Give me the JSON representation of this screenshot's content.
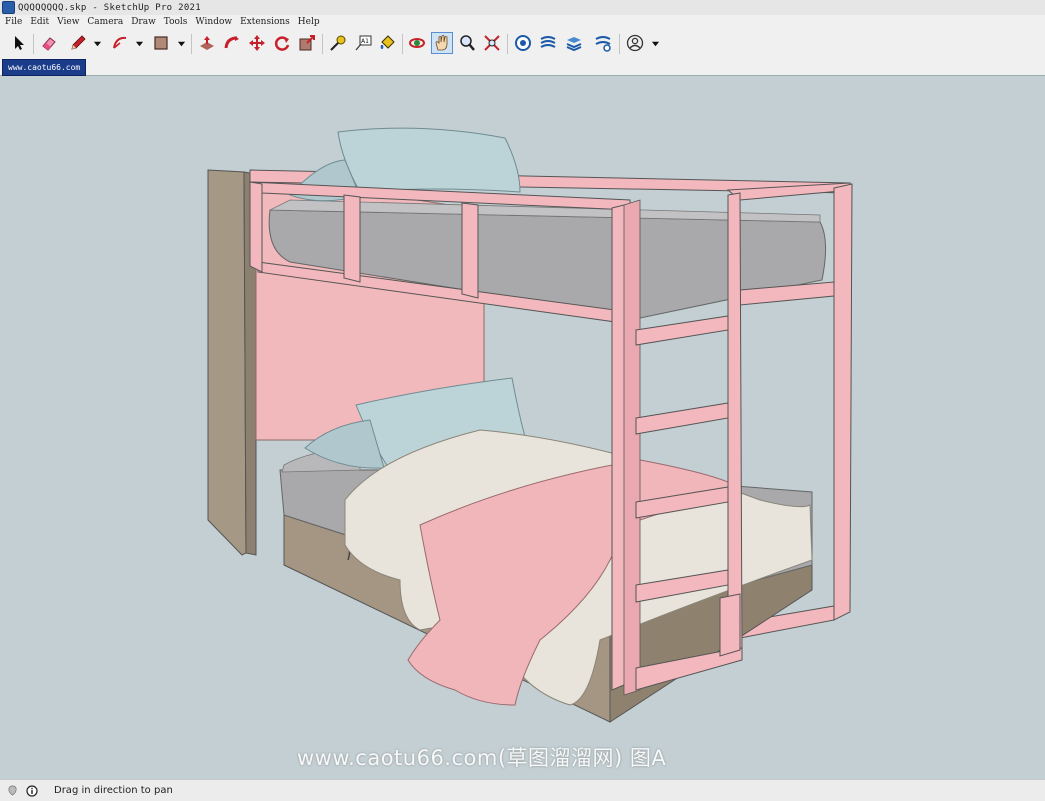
{
  "window": {
    "title": "QQQQQQQQ.skp - SketchUp Pro 2021"
  },
  "menu": [
    "File",
    "Edit",
    "View",
    "Camera",
    "Draw",
    "Tools",
    "Window",
    "Extensions",
    "Help"
  ],
  "toolbar": {
    "tools": [
      {
        "id": "select",
        "icon": "select-arrow-icon"
      },
      {
        "id": "eraser",
        "icon": "eraser-icon"
      },
      {
        "id": "pencil",
        "icon": "pencil-icon"
      },
      {
        "id": "arc",
        "icon": "arc-icon"
      },
      {
        "id": "rectangle",
        "icon": "rectangle-icon"
      },
      {
        "id": "push-pull",
        "icon": "push-pull-icon"
      },
      {
        "id": "follow-me",
        "icon": "follow-me-icon"
      },
      {
        "id": "move",
        "icon": "move-icon"
      },
      {
        "id": "rotate",
        "icon": "rotate-icon"
      },
      {
        "id": "scale",
        "icon": "scale-icon"
      },
      {
        "id": "tape-measure",
        "icon": "tape-measure-icon"
      },
      {
        "id": "text",
        "icon": "text-icon"
      },
      {
        "id": "paint-bucket",
        "icon": "paint-bucket-icon"
      },
      {
        "id": "orbit",
        "icon": "orbit-icon"
      },
      {
        "id": "pan",
        "icon": "pan-hand-icon",
        "active": true
      },
      {
        "id": "zoom",
        "icon": "zoom-icon"
      },
      {
        "id": "zoom-extents",
        "icon": "zoom-extents-icon"
      },
      {
        "id": "warehouse",
        "icon": "3d-warehouse-icon"
      },
      {
        "id": "extension-warehouse",
        "icon": "extension-warehouse-icon"
      },
      {
        "id": "layout",
        "icon": "layout-icon"
      },
      {
        "id": "extension-manager",
        "icon": "extension-manager-icon"
      },
      {
        "id": "account",
        "icon": "account-icon"
      }
    ]
  },
  "tab": {
    "label": "www.caotu66.com"
  },
  "watermark": "www.caotu66.com(草图溜溜网) 图A",
  "status": {
    "text": "Drag in direction to pan"
  },
  "colors": {
    "viewport": "#c3cfd3",
    "frame_pink": "#f3b8bd",
    "wood": "#a89a88",
    "mattress": "#a9a9ab",
    "pillow": "#b9d1d6",
    "duvet_pink": "#f0b7bb",
    "duvet_white": "#e9e6df"
  }
}
